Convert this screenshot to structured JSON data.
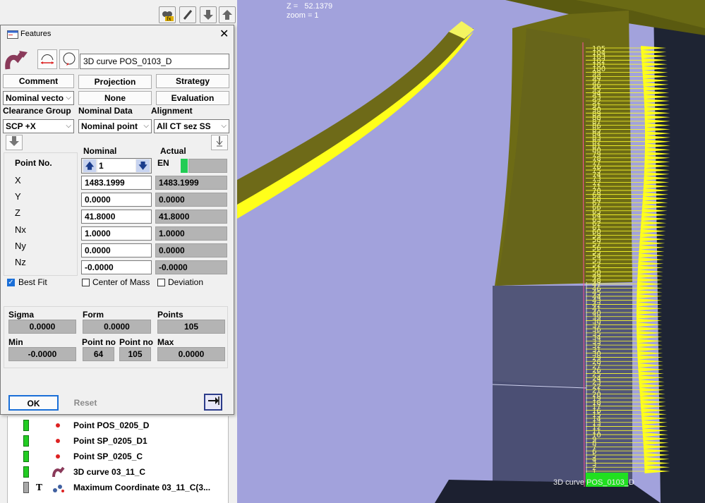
{
  "viewport": {
    "coord_z_label": "Z =",
    "coord_z_value": "52.1379",
    "zoom_text": "zoom = 1",
    "curve_label": "3D curve POS_0103_D",
    "point_numbers": [
      "105",
      "104",
      "103",
      "102",
      "101",
      "100",
      "99",
      "98",
      "97",
      "96",
      "95",
      "94",
      "93",
      "92",
      "91",
      "90",
      "89",
      "88",
      "87",
      "86",
      "85",
      "84",
      "83",
      "82",
      "81",
      "80",
      "79",
      "78",
      "77",
      "76",
      "75",
      "74",
      "73",
      "72",
      "71",
      "70",
      "69",
      "68",
      "67",
      "66",
      "65",
      "64",
      "63",
      "62",
      "61",
      "60",
      "59",
      "58",
      "57",
      "56",
      "55",
      "54",
      "53",
      "52",
      "51",
      "50",
      "49",
      "48",
      "47",
      "46",
      "45",
      "44",
      "43",
      "42",
      "41",
      "40",
      "39",
      "38",
      "37",
      "36",
      "35",
      "34",
      "33",
      "32",
      "31",
      "30",
      "29",
      "28",
      "27",
      "26",
      "25",
      "24",
      "23",
      "22",
      "21",
      "20",
      "19",
      "18",
      "17",
      "16",
      "15",
      "14",
      "13",
      "12",
      "11",
      "10",
      "9",
      "8",
      "7",
      "6",
      "5",
      "4",
      "3",
      "2",
      "1"
    ]
  },
  "toolbar": {
    "icons": [
      "binoculars-formula-icon",
      "pencil-icon",
      "arrow-down-icon",
      "arrow-up-icon"
    ]
  },
  "dialog": {
    "title": "Features",
    "feature_name": "3D curve POS_0103_D",
    "buttons_row1": {
      "comment": "Comment",
      "projection": "Projection",
      "strategy": "Strategy"
    },
    "dropdown_nominal_vector": "Nominal vecto",
    "none_button": "None",
    "evaluation_button": "Evaluation",
    "labels": {
      "clearance_group": "Clearance Group",
      "nominal_data": "Nominal Data",
      "alignment": "Alignment"
    },
    "dropdowns": {
      "clearance_group": "SCP +X",
      "nominal_data": "Nominal point",
      "alignment": "All CT sez SS"
    },
    "table": {
      "nominal_header": "Nominal",
      "actual_header": "Actual",
      "point_no_label": "Point No.",
      "point_no_value": "1",
      "actual_status": "EN",
      "rows": [
        {
          "label": "X",
          "nominal": "1483.1999",
          "actual": "1483.1999"
        },
        {
          "label": "Y",
          "nominal": "0.0000",
          "actual": "0.0000"
        },
        {
          "label": "Z",
          "nominal": "41.8000",
          "actual": "41.8000"
        },
        {
          "label": "Nx",
          "nominal": "1.0000",
          "actual": "1.0000"
        },
        {
          "label": "Ny",
          "nominal": "0.0000",
          "actual": "0.0000"
        },
        {
          "label": "Nz",
          "nominal": "-0.0000",
          "actual": "-0.0000"
        }
      ]
    },
    "checkboxes": {
      "best_fit": "Best Fit",
      "center_of_mass": "Center of Mass",
      "deviation": "Deviation"
    },
    "stats": {
      "sigma_label": "Sigma",
      "sigma_value": "0.0000",
      "form_label": "Form",
      "form_value": "0.0000",
      "points_label": "Points",
      "points_value": "105",
      "min_label": "Min",
      "min_value": "-0.0000",
      "point_no_min_label": "Point no",
      "point_no_min_value": "64",
      "point_no_max_label": "Point no",
      "point_no_max_value": "105",
      "max_label": "Max",
      "max_value": "0.0000"
    },
    "ok_button": "OK",
    "reset_button": "Reset"
  },
  "tree": {
    "items": [
      {
        "label": "Point POS_0205_D"
      },
      {
        "label": "Point SP_0205_D1"
      },
      {
        "label": "Point SP_0205_C"
      },
      {
        "label": "3D curve 03_11_C"
      },
      {
        "label": "Maximum Coordinate 03_11_C(3..."
      }
    ],
    "t_marker": "T"
  }
}
